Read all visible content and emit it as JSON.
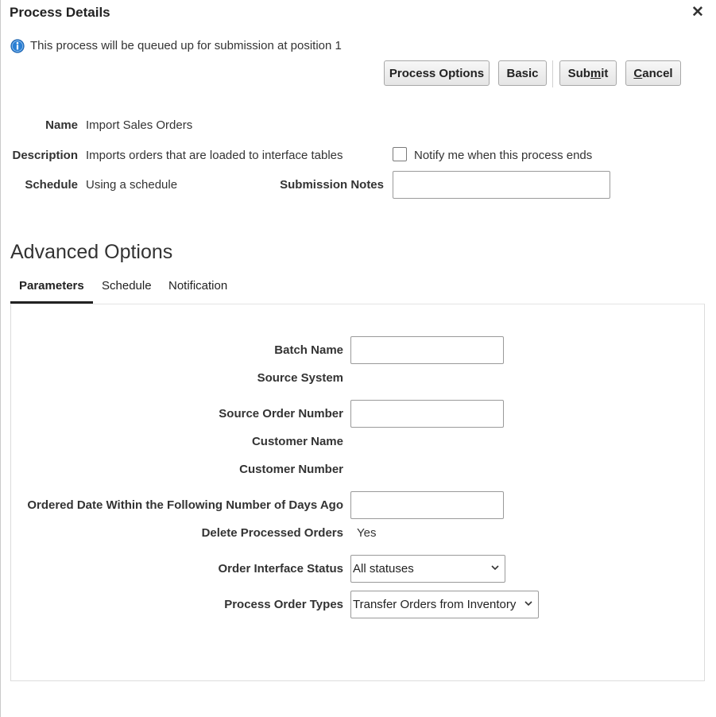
{
  "dialog": {
    "title": "Process Details",
    "info_message": "This process will be queued up for submission at position 1"
  },
  "toolbar": {
    "process_options_label": "Process Options",
    "basic_label": "Basic",
    "submit_pre": "Sub",
    "submit_mnemonic": "m",
    "submit_post": "it",
    "cancel_mnemonic": "C",
    "cancel_post": "ancel"
  },
  "details": {
    "name_label": "Name",
    "name_value": "Import Sales Orders",
    "description_label": "Description",
    "description_value": "Imports orders that are loaded to interface tables",
    "schedule_label": "Schedule",
    "schedule_value": "Using a schedule",
    "notify_label": "Notify me when this process ends",
    "notify_checked": false,
    "submission_notes_label": "Submission Notes",
    "submission_notes_value": ""
  },
  "advanced": {
    "heading": "Advanced Options",
    "tabs": [
      {
        "label": "Parameters",
        "active": true
      },
      {
        "label": "Schedule",
        "active": false
      },
      {
        "label": "Notification",
        "active": false
      }
    ]
  },
  "parameters": {
    "batch_name_label": "Batch Name",
    "batch_name_value": "",
    "source_system_label": "Source System",
    "source_order_number_label": "Source Order Number",
    "source_order_number_value": "",
    "customer_name_label": "Customer Name",
    "customer_number_label": "Customer Number",
    "ordered_date_label": "Ordered Date Within the Following Number of Days Ago",
    "ordered_date_value": "",
    "delete_processed_label": "Delete Processed Orders",
    "delete_processed_value": "Yes",
    "order_interface_status_label": "Order Interface Status",
    "order_interface_status_value": "All statuses",
    "process_order_types_label": "Process Order Types",
    "process_order_types_value": "Transfer Orders from Inventory"
  },
  "colors": {
    "info_blue": "#2a7fd4",
    "text": "#333333",
    "panel_border": "#dcdcdc"
  }
}
